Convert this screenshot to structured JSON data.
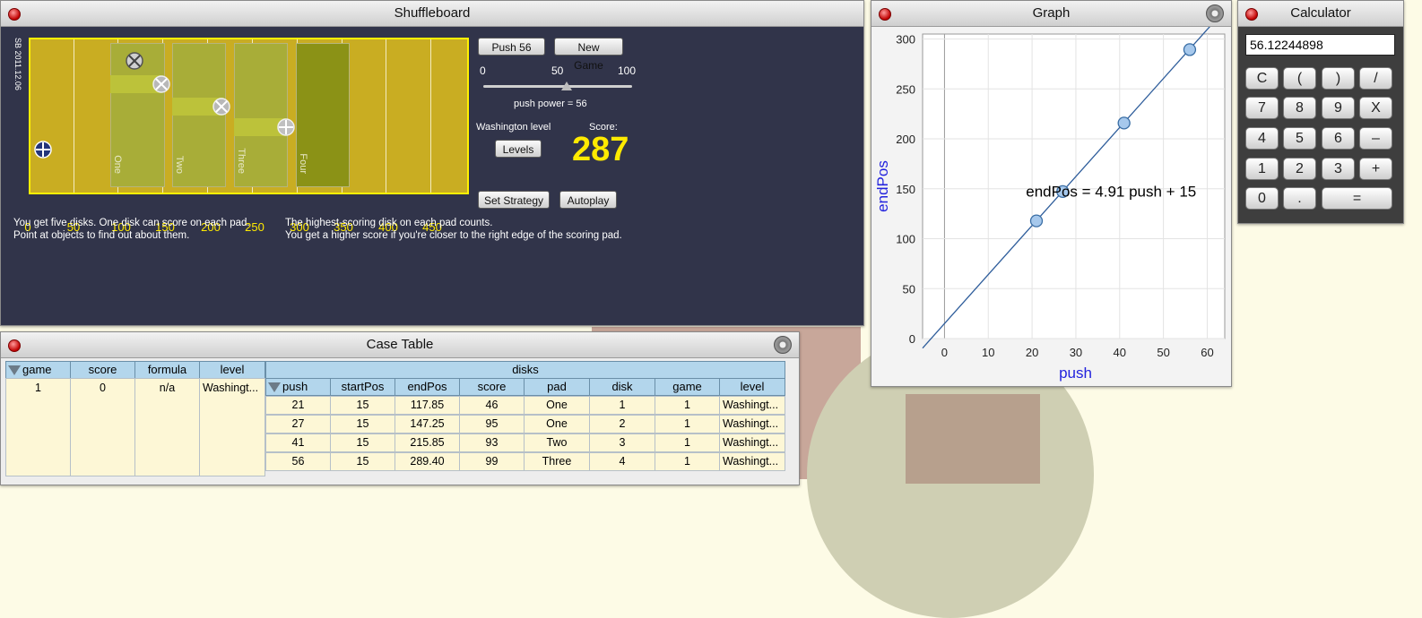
{
  "shuffleboard": {
    "title": "Shuffleboard",
    "version": "SB 2011.12.06",
    "pads": [
      "One",
      "Two",
      "Three",
      "Four"
    ],
    "axis_ticks": [
      "0",
      "50",
      "100",
      "150",
      "200",
      "250",
      "300",
      "350",
      "400",
      "450"
    ],
    "push_button": "Push 56",
    "new_game_button": "New Game",
    "slider_labels": [
      "0",
      "50",
      "100"
    ],
    "push_power_text": "push power = 56",
    "push_power_value": 56,
    "level_text": "Washington level",
    "levels_button": "Levels",
    "score_label": "Score:",
    "score_value": "287",
    "set_strategy_button": "Set Strategy",
    "autoplay_button": "Autoplay",
    "instructions_left_1": "You get five disks. One disk can score on each pad.",
    "instructions_left_2": "Point at objects to find out about them.",
    "instructions_right_1": "The highest-scoring disk on each pad counts.",
    "instructions_right_2": "You get a higher score if you're closer to the right edge of the scoring pad."
  },
  "graph": {
    "title": "Graph",
    "equation": "endPos = 4.91 push + 15",
    "xlabel": "push",
    "ylabel": "endPos",
    "x_ticks": [
      "0",
      "10",
      "20",
      "30",
      "40",
      "50",
      "60"
    ],
    "y_ticks": [
      "0",
      "50",
      "100",
      "150",
      "200",
      "250",
      "300"
    ]
  },
  "chart_data": {
    "type": "scatter",
    "title": "",
    "xlabel": "push",
    "ylabel": "endPos",
    "xlim": [
      -5,
      64
    ],
    "ylim": [
      0,
      305
    ],
    "points": [
      {
        "x": 21,
        "y": 117.85
      },
      {
        "x": 27,
        "y": 147.25
      },
      {
        "x": 41,
        "y": 215.85
      },
      {
        "x": 56,
        "y": 289.4
      }
    ],
    "fit_line": {
      "slope": 4.91,
      "intercept": 15,
      "label": "endPos = 4.91 push + 15"
    },
    "grid": true
  },
  "calculator": {
    "title": "Calculator",
    "display": "56.12244898",
    "keys": [
      "C",
      "(",
      ")",
      "/",
      "7",
      "8",
      "9",
      "X",
      "4",
      "5",
      "6",
      "–",
      "1",
      "2",
      "3",
      "+",
      "0",
      ".",
      "="
    ]
  },
  "case_table": {
    "title": "Case Table",
    "parent_group": "disks",
    "parent_headers": [
      "game",
      "score",
      "formula",
      "level"
    ],
    "parent_row": [
      "1",
      "0",
      "n/a",
      "Washingt..."
    ],
    "child_headers": [
      "push",
      "startPos",
      "endPos",
      "score",
      "pad",
      "disk",
      "game",
      "level"
    ],
    "child_rows": [
      [
        "21",
        "15",
        "117.85",
        "46",
        "One",
        "1",
        "1",
        "Washingt..."
      ],
      [
        "27",
        "15",
        "147.25",
        "95",
        "One",
        "2",
        "1",
        "Washingt..."
      ],
      [
        "41",
        "15",
        "215.85",
        "93",
        "Two",
        "3",
        "1",
        "Washingt..."
      ],
      [
        "56",
        "15",
        "289.40",
        "99",
        "Three",
        "4",
        "1",
        "Washingt..."
      ]
    ]
  }
}
